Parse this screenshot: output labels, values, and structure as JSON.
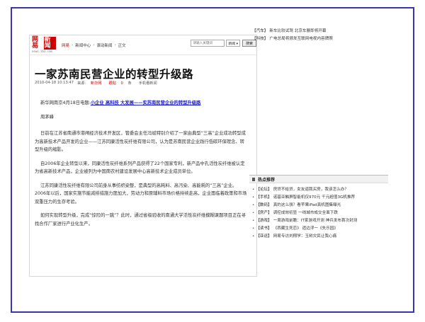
{
  "header": {
    "logo_main": "网易",
    "logo_sub": "新闻",
    "logo_url": "news.163.com",
    "breadcrumb": [
      "网易",
      "新闻中心",
      "滚动新闻",
      "正文"
    ],
    "search_placeholder": "请输入关键词",
    "search_scope": "新闻 ▾",
    "search_button": "搜索"
  },
  "article": {
    "title": "一家苏南民营企业的转型升级路",
    "datetime": "2010-04-18 10:13:47",
    "source_label": "来源:",
    "source": "新华网",
    "comments_label": "跟贴",
    "comments_count": "0",
    "comments_suffix": "条",
    "mobile_link": "手机看新闻",
    "lead_prefix": "新华网南京4月18日电题:",
    "lead_link": "小企业 高科技 大发展——实苏南民营企业的转型升级路",
    "author": "周茅峰",
    "paragraphs": [
      "日前在江苏省南通市港闸经济技术开发区，管委会主任冯斌特别介绍了一家由典型“三高”企业成功转型成为高新技术产品开发的企业——江苏同康活性炭纤维有限公司，认为是苏南民营企业践行低碳环保理念、转型升级的缩影。",
      "自2006年企业转型以来，同康活性炭纤维系列产品获得了22个国家专利，新产品中孔活性炭纤维被认定为省高新技术产品，企业被列为中国南农村建设发展中心高新技术企业成员单位。",
      "江苏同康活性炭纤维有限公司前身从事纺织染整，是典型的高耗料、高污染、高能耗的“三高”企业。2006年以后，国家实施节能减排措施力度加大，劳动力和原辅料市场价格持续走高，企业面临着政策和市场双重压力的生存考验。",
      "如何实现转型升级，完成“惊险的一跳”？此时，通过省级验收的南通大学活性炭纤维模糊课题项目正在寻找合作厂家进行产业化生产。"
    ]
  },
  "sidebar": {
    "top_news": [
      {
        "tag": "【汽车】",
        "text": "新车比较试驾 北京车展即将开幕"
      },
      {
        "tag": "【科技】",
        "text": "广电总局将颁发互联网电视内容牌照"
      }
    ],
    "hot_title": "热点推荐",
    "hot_list": [
      {
        "tag": "【论坛】",
        "text": "房贷不给贷，女友逼我买房，我该怎么办？"
      },
      {
        "tag": "【手机】",
        "text": "诺基亚触屏智能机仅970元 千元超值3G机推荐"
      },
      {
        "tag": "【数码】",
        "text": "真的这么强？看苹果iPad真机图集曝光"
      },
      {
        "tag": "【房产】",
        "text": "调控成效初显 一线城市成交全面下跌"
      },
      {
        "tag": "【游戏】",
        "text": "一周游戏前瞻：IT家游戏开测 神兵发布首次封测"
      },
      {
        "tag": "【读书】",
        "text": "《西藏生死恋》 遗边浮一《失乐园》"
      },
      {
        "tag": "【亚运】",
        "text": "网易专访刘翔学：玉树灾民让我心痛"
      }
    ]
  }
}
